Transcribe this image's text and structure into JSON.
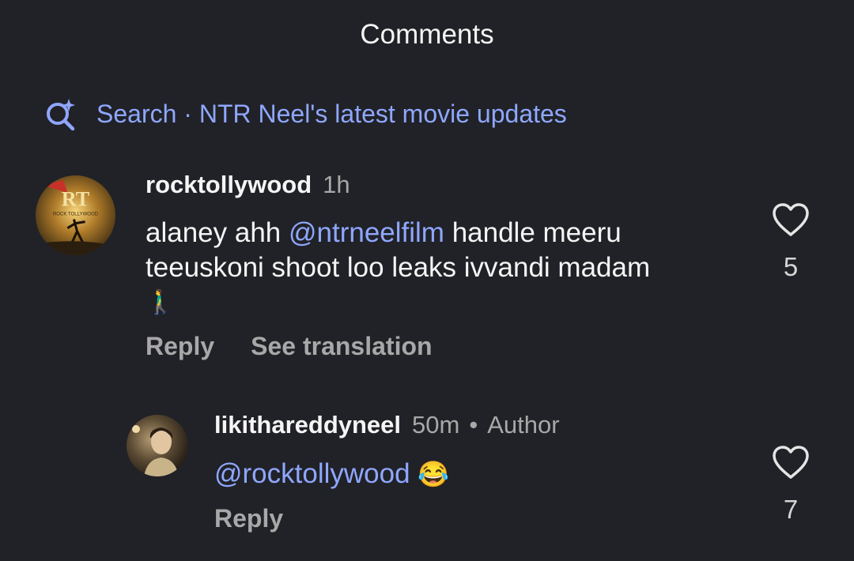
{
  "header": {
    "title": "Comments"
  },
  "search": {
    "prefix": "Search",
    "separator": " · ",
    "suggestion": "NTR Neel's latest movie updates"
  },
  "comments": [
    {
      "username": "rocktollywood",
      "time": "1h",
      "mention": "@ntrneelfilm",
      "text_after_mention": " handle meeru",
      "text_line2": "teeuskoni shoot loo leaks ivvandi madam",
      "emoji": "🚶‍♂️",
      "actions": [
        "Reply",
        "See translation"
      ],
      "likes": "5",
      "avatar_label": "RT",
      "avatar_sub": "ROCK TOLLYWOOD"
    },
    {
      "username": "likithareddyneel",
      "time": "50m",
      "dot": "•",
      "author_badge": "Author",
      "mention": "@rocktollywood",
      "emoji": "😂",
      "actions": [
        "Reply"
      ],
      "likes": "7"
    }
  ]
}
